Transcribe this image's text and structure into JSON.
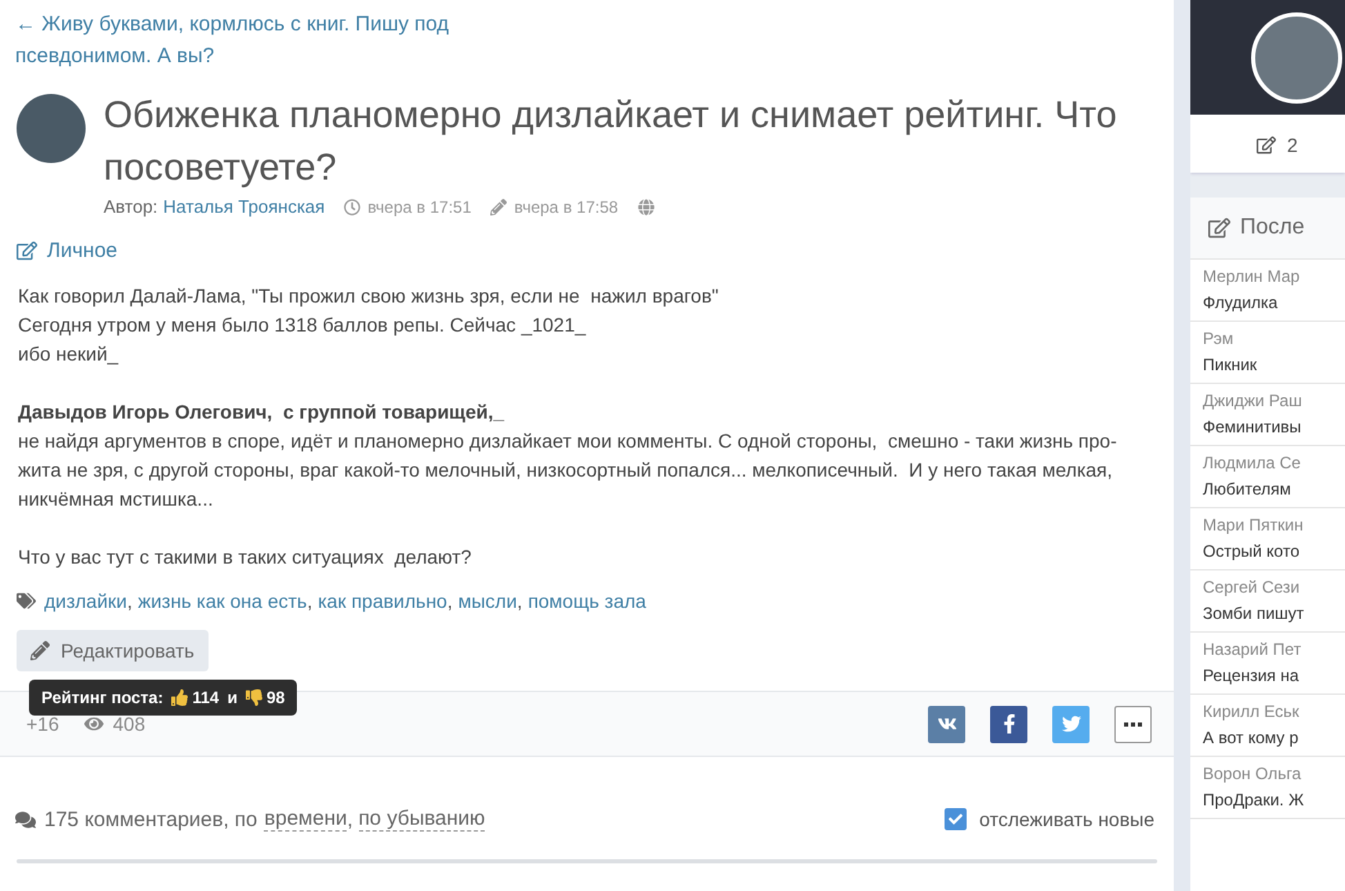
{
  "back_link": {
    "arrow": "←",
    "text": "Живу буквами, кормлюсь с книг. Пишу под псевдонимом. А вы?"
  },
  "post": {
    "title": "Обиженка планомерно дизлайкает и снимает рейтинг. Что посоветуете?",
    "author_label": "Автор:",
    "author": "Наталья Троянская",
    "created": "вчера в 17:51",
    "edited": "вчера в 17:58",
    "blog": "Личное",
    "paragraphs": [
      {
        "lines": [
          {
            "text": "Как говорил Далай-Лама, \"Ты прожил свою жизнь зря, если не  нажил врагов\"",
            "bold": false
          },
          {
            "text": "Сегодня утром у меня было 1318 баллов репы. Сейчас _1021_",
            "bold": false
          },
          {
            "text": "ибо некий_",
            "bold": false
          }
        ]
      },
      {
        "lines": [
          {
            "text": "Давыдов Игорь Олегович,  с группой товарищей,_",
            "bold": true
          },
          {
            "text": "не найдя аргументов в споре, идёт и планомерно дизлайкает мои комменты. С одной стороны,  смешно - таки жизнь про-",
            "bold": false
          },
          {
            "text": "жита не зря, с другой стороны, враг какой-то мелочный, низкосортный попался... мелкописечный.  И у него такая мелкая,",
            "bold": false
          },
          {
            "text": "никчёмная мстишка...",
            "bold": false
          }
        ]
      },
      {
        "lines": [
          {
            "text": "Что у вас тут с такими в таких ситуациях  делают?",
            "bold": false
          }
        ]
      }
    ],
    "tags": [
      "дизлайки",
      "жизнь как она есть",
      "как правильно",
      "мысли",
      "помощь зала"
    ],
    "tag_separator": ",",
    "edit_button": "Редактировать",
    "tooltip": {
      "label": "Рейтинг поста:",
      "likes": "114",
      "joiner": "и",
      "dislikes": "98"
    },
    "rating": "+16",
    "views": "408",
    "share": [
      {
        "kind": "vk"
      },
      {
        "kind": "facebook"
      },
      {
        "kind": "twitter"
      },
      {
        "kind": "more"
      }
    ]
  },
  "comments": {
    "count": "175 комментариев, по",
    "sorts": [
      "времени",
      "по убыванию"
    ],
    "separator": ",",
    "track_label": "отслеживать новые",
    "track_checked": true
  },
  "sidebar": {
    "profile": {
      "count": "2"
    },
    "panel_title": "После",
    "items": [
      {
        "author": "Мерлин Мар",
        "title": "Флудилка"
      },
      {
        "author": "Рэм",
        "title": "Пикник"
      },
      {
        "author": "Джиджи Раш",
        "title": "Феминитивы"
      },
      {
        "author": "Людмила Се",
        "title": "Любителям"
      },
      {
        "author": "Мари Пяткин",
        "title": "Острый кото"
      },
      {
        "author": "Сергей Сези",
        "title": "Зомби пишут"
      },
      {
        "author": "Назарий Пет",
        "title": "Рецензия на"
      },
      {
        "author": "Кирилл Еськ",
        "title": "А вот кому р"
      },
      {
        "author": "Ворон Ольга",
        "title": "ПроДраки. Ж"
      }
    ]
  }
}
